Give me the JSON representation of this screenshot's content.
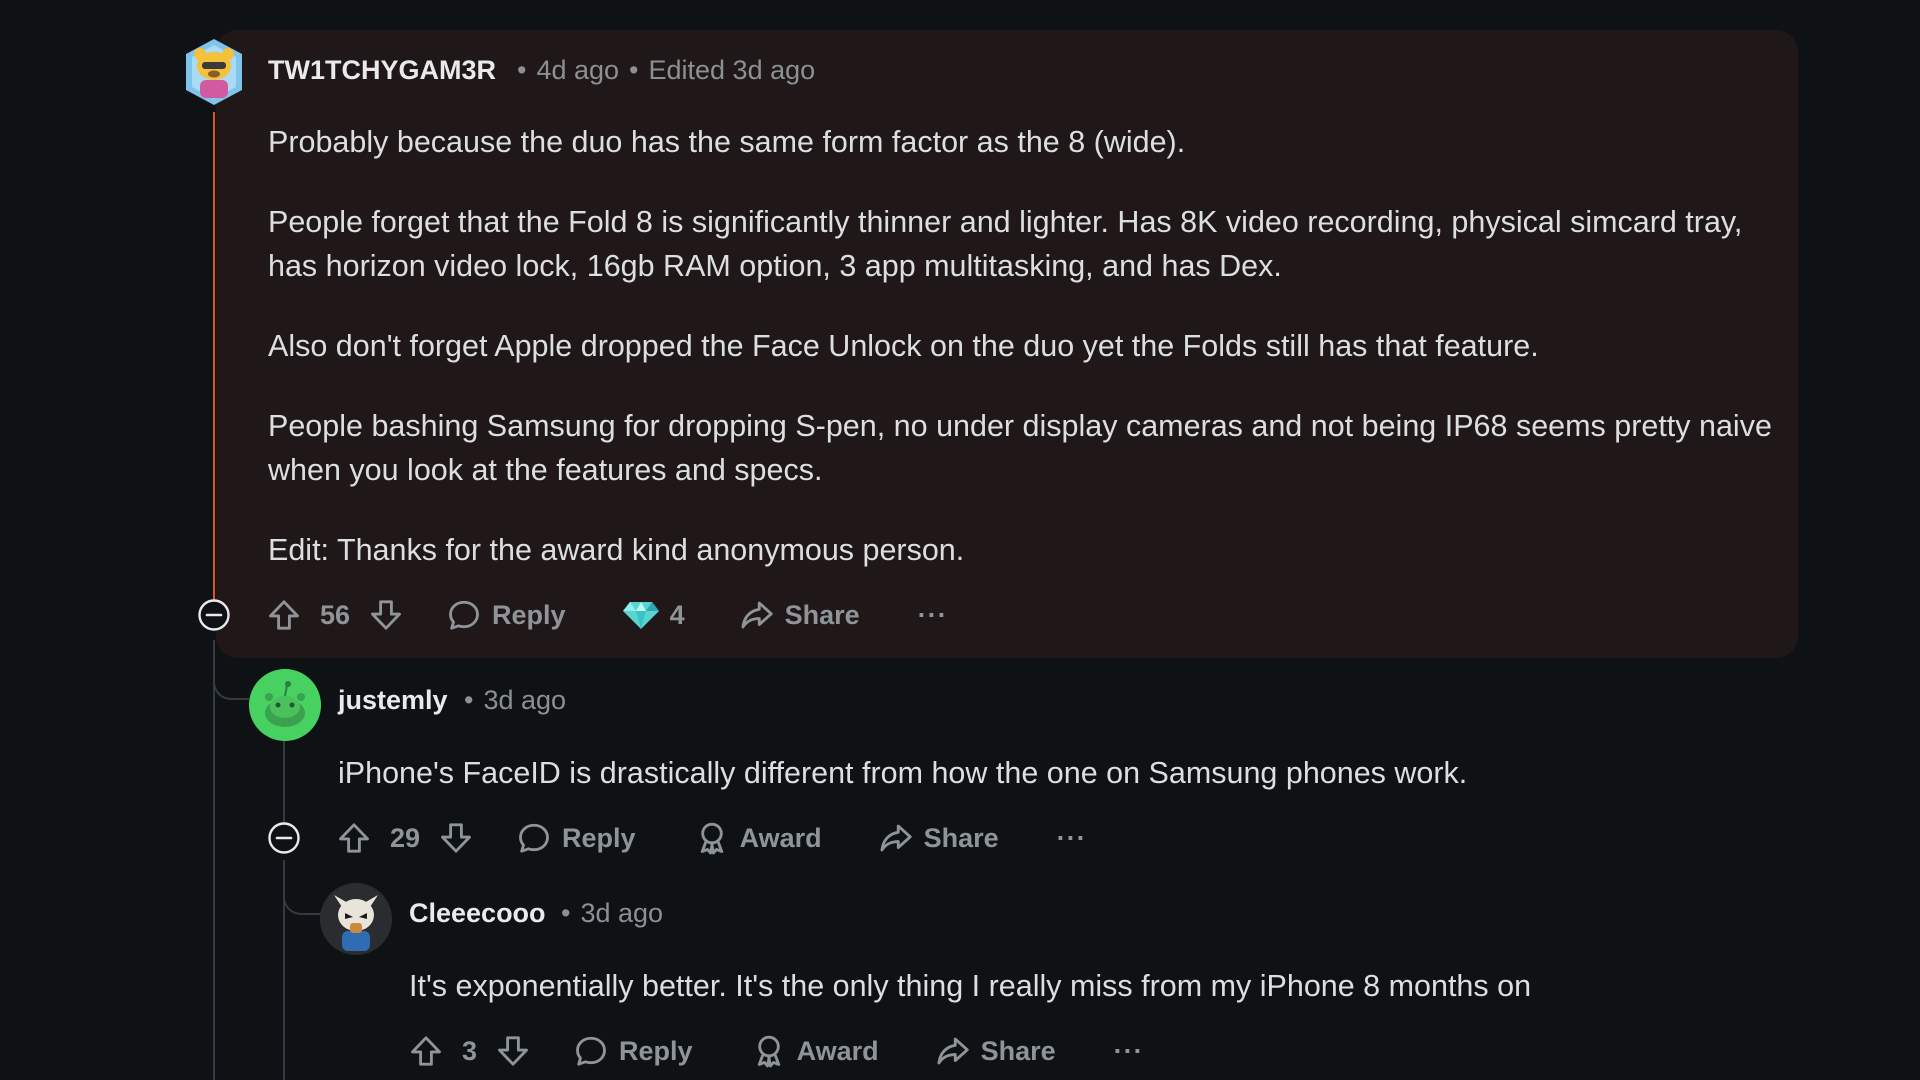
{
  "colors": {
    "background": "#0f1214",
    "highlight_background": "#201718",
    "thread_line_active": "#e0552c",
    "thread_line": "#343a3f",
    "text": "#dcdfe1",
    "muted": "#8b9094"
  },
  "comments": [
    {
      "username": "TW1TCHYGAM3R",
      "time": "4d ago",
      "edited": "Edited 3d ago",
      "paragraphs": [
        "Probably because the duo has the same form factor as the 8 (wide).",
        "People forget that the Fold 8 is significantly thinner and lighter. Has 8K video recording, physical simcard tray, has horizon video lock, 16gb RAM option, 3 app multitasking, and has Dex.",
        "Also don't forget Apple dropped the Face Unlock on the duo yet the Folds still has that feature.",
        "People bashing Samsung for dropping S-pen, no under display cameras and not being IP68 seems pretty naive when you look at the features and specs.",
        "Edit: Thanks for the award kind anonymous person."
      ],
      "score": "56",
      "reply_label": "Reply",
      "award_count": "4",
      "share_label": "Share",
      "more_label": "···"
    },
    {
      "username": "justemly",
      "time": "3d ago",
      "paragraphs": [
        "iPhone's FaceID is drastically different from how the one on Samsung phones work."
      ],
      "score": "29",
      "reply_label": "Reply",
      "award_label": "Award",
      "share_label": "Share",
      "more_label": "···"
    },
    {
      "username": "Cleeecooo",
      "time": "3d ago",
      "paragraphs": [
        "It's exponentially better. It's the only thing I really miss from my iPhone 8 months on"
      ],
      "score": "3",
      "reply_label": "Reply",
      "award_label": "Award",
      "share_label": "Share",
      "more_label": "···"
    }
  ]
}
